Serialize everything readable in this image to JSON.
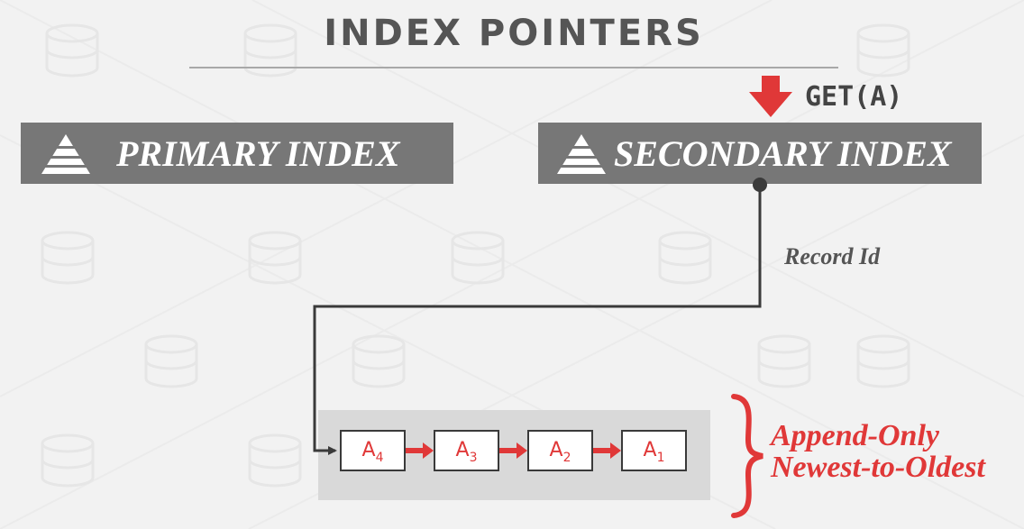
{
  "title": "INDEX POINTERS",
  "primary_index": {
    "label": "PRIMARY INDEX",
    "icon": "pyramid-icon"
  },
  "secondary_index": {
    "label": "SECONDARY INDEX",
    "icon": "pyramid-icon"
  },
  "query": {
    "text": "GET(A)",
    "icon": "down-arrow-icon"
  },
  "pointer_label": "Record Id",
  "version_chain": [
    {
      "base": "A",
      "sub": "4"
    },
    {
      "base": "A",
      "sub": "3"
    },
    {
      "base": "A",
      "sub": "2"
    },
    {
      "base": "A",
      "sub": "1"
    }
  ],
  "annotation": {
    "line1": "Append-Only",
    "line2": "Newest-to-Oldest"
  },
  "colors": {
    "accent_red": "#e03838",
    "box_gray": "#777777",
    "text_gray": "#555555",
    "panel_gray": "#d9d9d9",
    "background": "#f2f2f2"
  }
}
